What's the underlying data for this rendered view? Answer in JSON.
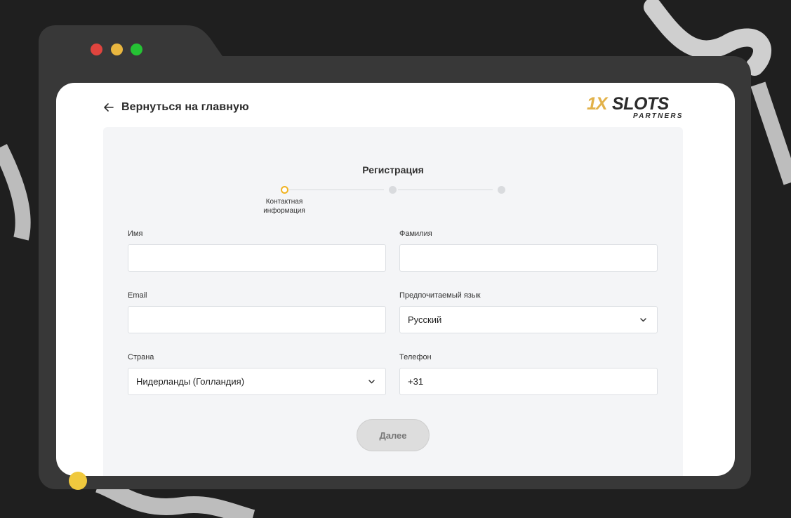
{
  "window": {
    "controls": [
      "close",
      "minimize",
      "maximize"
    ],
    "colors": {
      "close": "#e0443e",
      "minimize": "#e9b63f",
      "maximize": "#25c334"
    }
  },
  "header": {
    "back_label": "Вернуться на главную",
    "back_icon": "arrow-left-icon",
    "logo": {
      "brand": "1XSLOTS",
      "subtitle": "PARTNERS"
    }
  },
  "form": {
    "title": "Регистрация",
    "steps": [
      {
        "label": "Контактная информация",
        "state": "active"
      },
      {
        "label": "",
        "state": "inactive"
      },
      {
        "label": "",
        "state": "inactive"
      }
    ],
    "fields": {
      "first_name": {
        "label": "Имя",
        "value": ""
      },
      "last_name": {
        "label": "Фамилия",
        "value": ""
      },
      "email": {
        "label": "Email",
        "value": ""
      },
      "language": {
        "label": "Предпочитаемый язык",
        "value": "Русский"
      },
      "country": {
        "label": "Страна",
        "value": "Нидерланды (Голландия)"
      },
      "phone": {
        "label": "Телефон",
        "value": "+31"
      }
    },
    "next_label": "Далее"
  },
  "colors": {
    "accent": "#f0b323",
    "page_bg": "#1f1f1f",
    "card_bg": "#f4f5f7"
  }
}
